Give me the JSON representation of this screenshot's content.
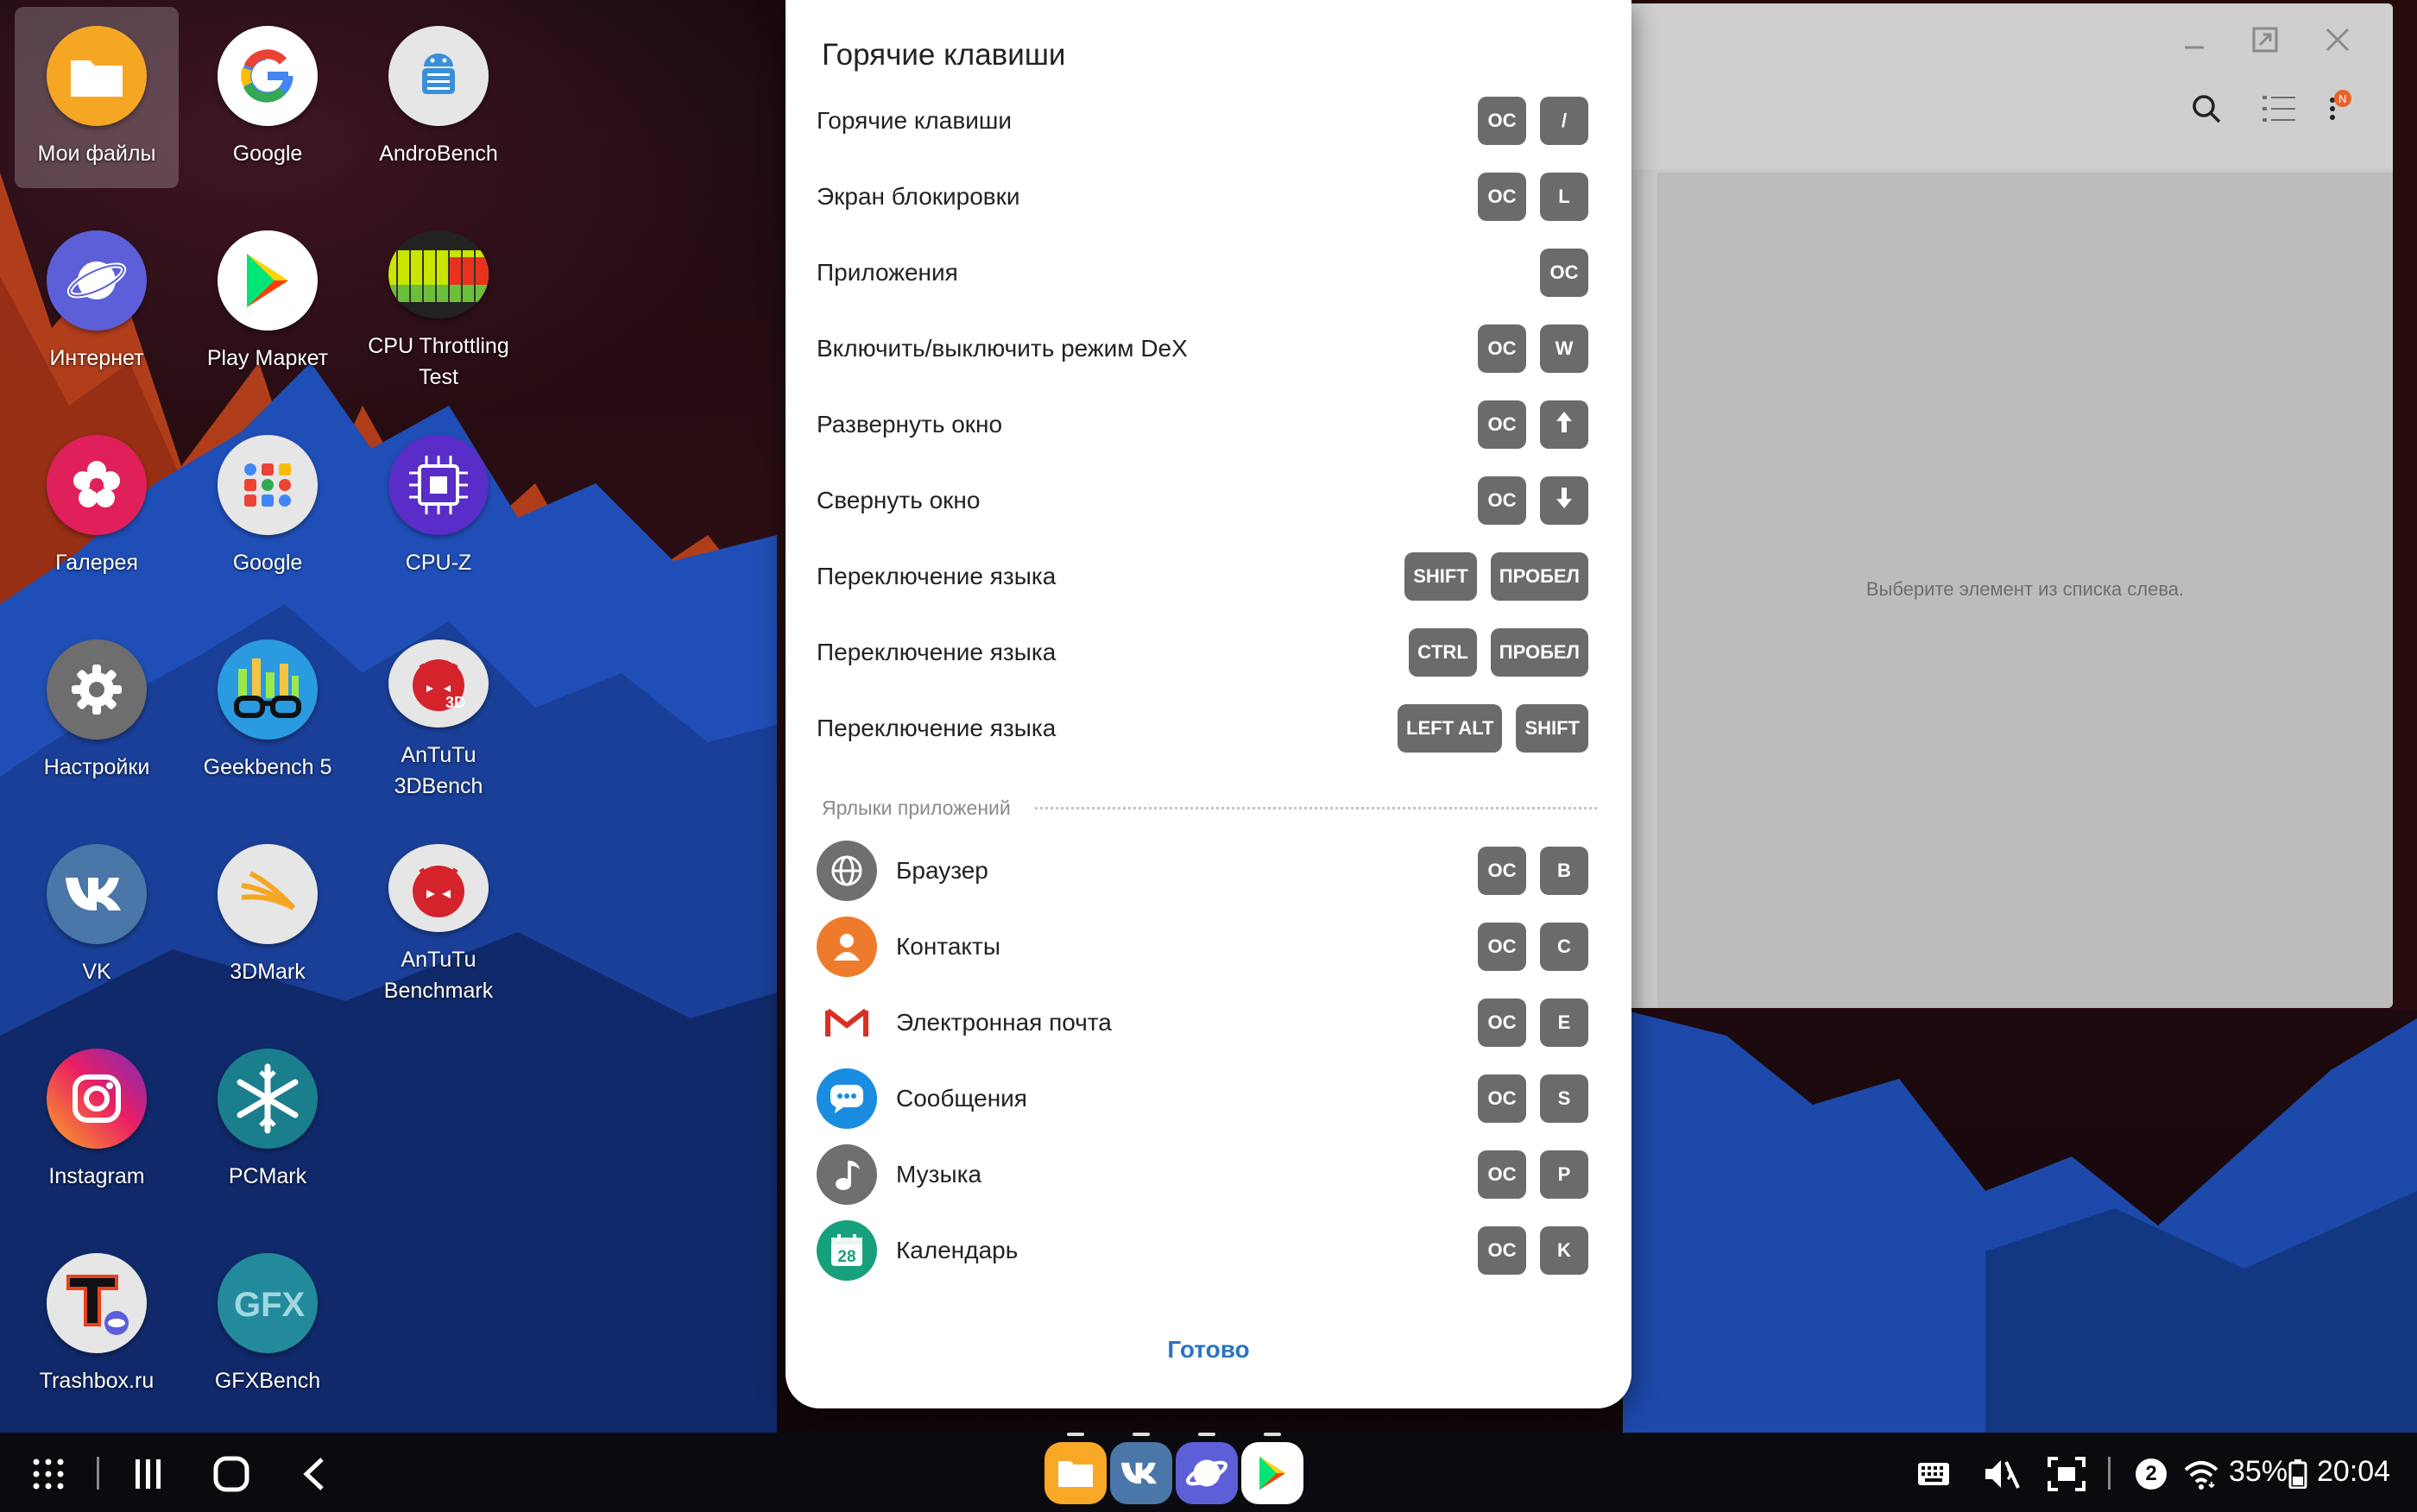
{
  "desktop": {
    "icons": [
      {
        "label": "Мои файлы",
        "icon": "folder-icon"
      },
      {
        "label": "Google",
        "icon": "google-icon"
      },
      {
        "label": "AndroBench",
        "icon": "androbench-icon"
      },
      {
        "label": "Интернет",
        "icon": "internet-icon"
      },
      {
        "label": "Play Маркет",
        "icon": "play-store-icon"
      },
      {
        "label": "CPU Throttling\nTest",
        "icon": "cpu-throttling-icon"
      },
      {
        "label": "Галерея",
        "icon": "gallery-icon"
      },
      {
        "label": "Google",
        "icon": "google-folder-icon"
      },
      {
        "label": "CPU-Z",
        "icon": "cpu-z-icon"
      },
      {
        "label": "Настройки",
        "icon": "settings-icon"
      },
      {
        "label": "Geekbench 5",
        "icon": "geekbench-icon"
      },
      {
        "label": "AnTuTu\n3DBench",
        "icon": "antutu-3d-icon"
      },
      {
        "label": "VK",
        "icon": "vk-icon"
      },
      {
        "label": "3DMark",
        "icon": "3dmark-icon"
      },
      {
        "label": "AnTuTu\nBenchmark",
        "icon": "antutu-icon"
      },
      {
        "label": "Instagram",
        "icon": "instagram-icon"
      },
      {
        "label": "PCMark",
        "icon": "pcmark-icon"
      },
      {
        "label": "Trashbox.ru",
        "icon": "trashbox-icon"
      },
      {
        "label": "GFXBench",
        "icon": "gfxbench-icon"
      }
    ]
  },
  "background_window": {
    "empty_text": "Выберите элемент из списка слева."
  },
  "dialog": {
    "title": "Горячие клавиши",
    "shortcuts": [
      {
        "label": "Горячие клавиши",
        "keys": [
          "ОС",
          "/"
        ]
      },
      {
        "label": "Экран блокировки",
        "keys": [
          "ОС",
          "L"
        ]
      },
      {
        "label": "Приложения",
        "keys": [
          "ОС"
        ]
      },
      {
        "label": "Включить/выключить режим DeX",
        "keys": [
          "ОС",
          "W"
        ]
      },
      {
        "label": "Развернуть окно",
        "keys": [
          "ОС",
          "arrow-up-icon"
        ]
      },
      {
        "label": "Свернуть окно",
        "keys": [
          "ОС",
          "arrow-down-icon"
        ]
      },
      {
        "label": "Переключение языка",
        "keys": [
          "SHIFT",
          "ПРОБЕЛ"
        ]
      },
      {
        "label": "Переключение языка",
        "keys": [
          "CTRL",
          "ПРОБЕЛ"
        ]
      },
      {
        "label": "Переключение языка",
        "keys": [
          "LEFT ALT",
          "SHIFT"
        ]
      }
    ],
    "section_title": "Ярлыки приложений",
    "app_shortcuts": [
      {
        "label": "Браузер",
        "icon": "globe-icon",
        "color": "#6f6f6f",
        "keys": [
          "ОС",
          "B"
        ]
      },
      {
        "label": "Контакты",
        "icon": "person-icon",
        "color": "#ee7b2c",
        "keys": [
          "ОС",
          "C"
        ]
      },
      {
        "label": "Электронная почта",
        "icon": "gmail-icon",
        "color": "#ffffff",
        "keys": [
          "ОС",
          "E"
        ]
      },
      {
        "label": "Сообщения",
        "icon": "chat-icon",
        "color": "#1a8de0",
        "keys": [
          "ОС",
          "S"
        ]
      },
      {
        "label": "Музыка",
        "icon": "music-note-icon",
        "color": "#6f6f6f",
        "keys": [
          "ОС",
          "P"
        ]
      },
      {
        "label": "Календарь",
        "icon": "calendar-icon",
        "color": "#17a07c",
        "keys": [
          "ОС",
          "K"
        ],
        "day": "28"
      }
    ],
    "done_label": "Готово"
  },
  "taskbar": {
    "dock": [
      {
        "icon": "my-files-icon",
        "color": "#f9a825"
      },
      {
        "icon": "vk-icon",
        "color": "#4a76a8"
      },
      {
        "icon": "internet-icon",
        "color": "#5c5fd8"
      },
      {
        "icon": "play-store-icon",
        "color": "#ffffff"
      }
    ],
    "notification_count": "2",
    "battery": "35%",
    "time": "20:04"
  }
}
